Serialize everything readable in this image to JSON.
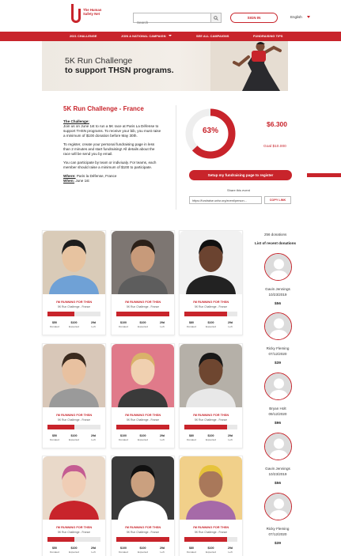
{
  "header": {
    "logo_text": "The Human Safety Net",
    "search_placeholder": "Search",
    "signin_label": "SIGN IN",
    "language": "English"
  },
  "nav": {
    "items": [
      {
        "label": "2021 CHALLENGE"
      },
      {
        "label": "JOIN A NATIONAL CAMPAIGN"
      },
      {
        "label": "SEE ALL CAMPAIGNS"
      },
      {
        "label": "FUNDRAISING TIPS"
      }
    ]
  },
  "banner": {
    "line1": "5K Run Challenge",
    "line2": "to support THSN programs."
  },
  "challenge": {
    "title": "5K Run Challenge - France",
    "heading": "The Challenge:",
    "intro": "Join us on June 1st to run a 5K race at Paris La Défense to support THSN programs. To receive your bib, you must raise a minimum of $100 donation before May 30th.",
    "register": "To register, create your personal fundraising page in less than 2 minutes and start fundraising! All details about the race will be send you by email.",
    "team": "You can participate by team or indiviualy. For teams, each member should raise a minimum of $100 to participate.",
    "where_label": "Where:",
    "where_value": "Paris la Défense, France",
    "when_label": "When:",
    "when_value": "June 1st"
  },
  "progress": {
    "percent_label": "63%",
    "percent": 63,
    "raised": "$6.300",
    "goal": "Goal $10.000",
    "setup_label": "Setup my fundraising page to register",
    "share_label": "Share this event",
    "share_url": "https://fundraise.unlsr.org/event/person...",
    "copy_label": "COPY LINK"
  },
  "runners": [
    {
      "running": "I'M RUNNING FOR THSN",
      "challenge": "5K Run Challenge - France",
      "progress": 0.5,
      "donated": "$50",
      "expected": "$100",
      "left": "29d",
      "donated_label": "Donated",
      "expected_label": "Expected",
      "left_label": "Left"
    },
    {
      "running": "I'M RUNNING FOR THSN",
      "challenge": "5K Run Challenge - France",
      "progress": 1.0,
      "donated": "$100",
      "expected": "$100",
      "left": "29d",
      "donated_label": "Donated",
      "expected_label": "Expected",
      "left_label": "Left"
    },
    {
      "running": "I'M RUNNING FOR THSN",
      "challenge": "5K Run Challenge - France",
      "progress": 0.8,
      "donated": "$80",
      "expected": "$100",
      "left": "29d",
      "donated_label": "Donated",
      "expected_label": "Expected",
      "left_label": "Left"
    },
    {
      "running": "I'M RUNNING FOR THSN",
      "challenge": "5K Run Challenge - France",
      "progress": 0.5,
      "donated": "$50",
      "expected": "$100",
      "left": "29d",
      "donated_label": "Donated",
      "expected_label": "Expected",
      "left_label": "Left"
    },
    {
      "running": "I'M RUNNING FOR THSN",
      "challenge": "5K Run Challenge - France",
      "progress": 1.0,
      "donated": "$100",
      "expected": "$100",
      "left": "29d",
      "donated_label": "Donated",
      "expected_label": "Expected",
      "left_label": "Left"
    },
    {
      "running": "I'M RUNNING FOR THSN",
      "challenge": "5K Run Challenge - France",
      "progress": 0.8,
      "donated": "$80",
      "expected": "$100",
      "left": "29d",
      "donated_label": "Donated",
      "expected_label": "Expected",
      "left_label": "Left"
    },
    {
      "running": "I'M RUNNING FOR THSN",
      "challenge": "5K Run Challenge - France",
      "progress": 0.5,
      "donated": "$50",
      "expected": "$100",
      "left": "29d",
      "donated_label": "Donated",
      "expected_label": "Expected",
      "left_label": "Left"
    },
    {
      "running": "I'M RUNNING FOR THSN",
      "challenge": "5K Run Challenge - France",
      "progress": 1.0,
      "donated": "$100",
      "expected": "$100",
      "left": "29d",
      "donated_label": "Donated",
      "expected_label": "Expected",
      "left_label": "Left"
    },
    {
      "running": "I'M RUNNING FOR THSN",
      "challenge": "5K Run Challenge - France",
      "progress": 0.8,
      "donated": "$80",
      "expected": "$100",
      "left": "29d",
      "donated_label": "Donated",
      "expected_label": "Expected",
      "left_label": "Left"
    }
  ],
  "donations": {
    "count": "256 donations",
    "title": "List of recent donations",
    "items": [
      {
        "name": "Gavin Jennings",
        "date": "10/23/2019",
        "amount": "$56"
      },
      {
        "name": "Ricky Fleming",
        "date": "07/12/2020",
        "amount": "$39"
      },
      {
        "name": "Bryan Holt",
        "date": "09/12/2020",
        "amount": "$96"
      },
      {
        "name": "Gavin Jennings",
        "date": "10/23/2019",
        "amount": "$56"
      },
      {
        "name": "Ricky Fleming",
        "date": "07/12/2020",
        "amount": "$39"
      }
    ]
  },
  "colors": {
    "accent": "#c8242b",
    "gauge_track": "#eeeeee"
  }
}
